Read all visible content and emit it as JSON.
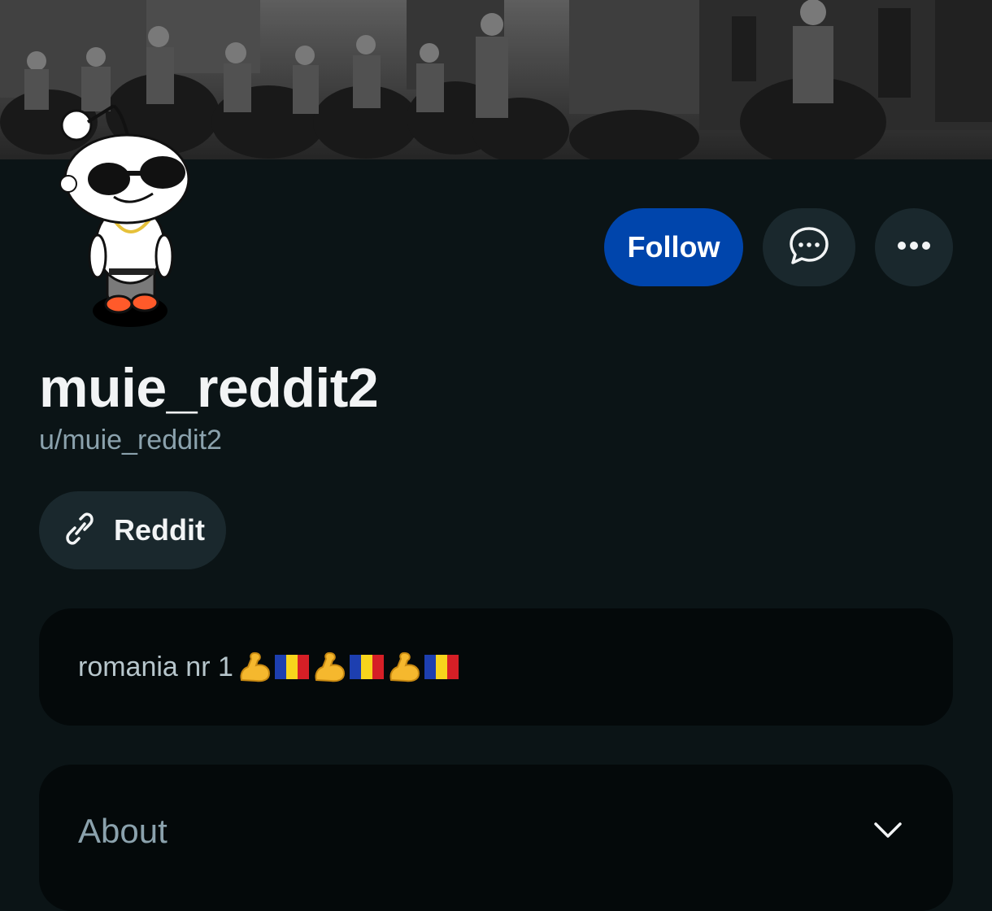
{
  "profile": {
    "display_name": "muie_reddit2",
    "username": "u/muie_reddit2",
    "follow_label": "Follow",
    "social_link_label": "Reddit",
    "bio_text": "romania nr 1",
    "about_label": "About"
  },
  "icons": {
    "message": "chat-bubble-icon",
    "more": "more-dots-icon",
    "link": "link-icon",
    "chevron": "chevron-down-icon",
    "bio_emojis": [
      "flexed-biceps",
      "romania-flag",
      "flexed-biceps",
      "romania-flag",
      "flexed-biceps",
      "romania-flag"
    ]
  },
  "colors": {
    "background": "#0b1416",
    "follow_button": "#0045ac",
    "secondary_button": "#1a282d",
    "card": "#04090a",
    "muted_text": "#8ba2ad"
  }
}
